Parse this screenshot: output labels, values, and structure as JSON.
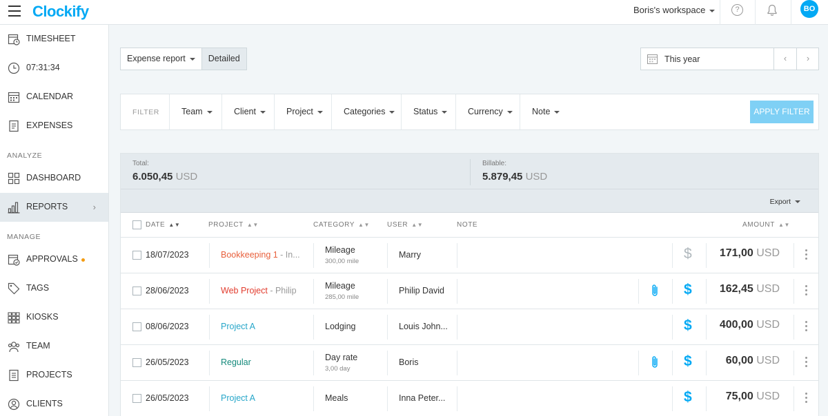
{
  "app": {
    "logo": "Clockify",
    "workspace": "Boris's workspace",
    "avatar": "BO"
  },
  "sidebar": {
    "items_top": [
      {
        "label": "TIMESHEET",
        "icon": "timesheet-icon"
      },
      {
        "label": "07:31:34",
        "icon": "clock-icon"
      },
      {
        "label": "CALENDAR",
        "icon": "calendar-icon"
      },
      {
        "label": "EXPENSES",
        "icon": "expenses-icon"
      }
    ],
    "section_analyze": "ANALYZE",
    "items_analyze": [
      {
        "label": "DASHBOARD",
        "icon": "dashboard-icon"
      },
      {
        "label": "REPORTS",
        "icon": "reports-icon"
      }
    ],
    "section_manage": "MANAGE",
    "items_manage": [
      {
        "label": "APPROVALS",
        "icon": "approvals-icon"
      },
      {
        "label": "TAGS",
        "icon": "tag-icon"
      },
      {
        "label": "KIOSKS",
        "icon": "kiosk-icon"
      },
      {
        "label": "TEAM",
        "icon": "team-icon"
      },
      {
        "label": "PROJECTS",
        "icon": "projects-icon"
      },
      {
        "label": "CLIENTS",
        "icon": "clients-icon"
      }
    ]
  },
  "report_type": {
    "selected": "Expense report",
    "detailed": "Detailed"
  },
  "date_range": {
    "label": "This year",
    "prev": "‹",
    "next": "›"
  },
  "filter": {
    "label": "FILTER",
    "items": [
      "Team",
      "Client",
      "Project",
      "Categories",
      "Status",
      "Currency",
      "Note"
    ],
    "apply": "APPLY FILTER"
  },
  "summary": {
    "total_label": "Total:",
    "total_value": "6.050,45",
    "total_currency": "USD",
    "billable_label": "Billable:",
    "billable_value": "5.879,45",
    "billable_currency": "USD"
  },
  "export_label": "Export",
  "columns": {
    "date": "DATE",
    "project": "PROJECT",
    "category": "CATEGORY",
    "user": "USER",
    "note": "NOTE",
    "amount": "AMOUNT"
  },
  "rows": [
    {
      "date": "18/07/2023",
      "project": "Bookkeeping 1",
      "client": " - In...",
      "project_color": "#e8603c",
      "category": "Mileage",
      "category_sub": "300,00 mile",
      "user": "Marry",
      "attachment": false,
      "billable": false,
      "amount": "171,00",
      "currency": "USD"
    },
    {
      "date": "28/06/2023",
      "project": "Web Project",
      "client": " - Philip",
      "project_color": "#e23c2e",
      "category": "Mileage",
      "category_sub": "285,00 mile",
      "user": "Philip David",
      "attachment": true,
      "billable": true,
      "amount": "162,45",
      "currency": "USD"
    },
    {
      "date": "08/06/2023",
      "project": "Project A",
      "client": "",
      "project_color": "#26a6c9",
      "category": "Lodging",
      "category_sub": "",
      "user": "Louis John...",
      "attachment": false,
      "billable": true,
      "amount": "400,00",
      "currency": "USD"
    },
    {
      "date": "26/05/2023",
      "project": "Regular",
      "client": "",
      "project_color": "#14897b",
      "category": "Day rate",
      "category_sub": "3,00 day",
      "user": "Boris",
      "attachment": true,
      "billable": true,
      "amount": "60,00",
      "currency": "USD"
    },
    {
      "date": "26/05/2023",
      "project": "Project A",
      "client": "",
      "project_color": "#26a6c9",
      "category": "Meals",
      "category_sub": "",
      "user": "Inna Peter...",
      "attachment": false,
      "billable": true,
      "amount": "75,00",
      "currency": "USD"
    }
  ],
  "colors": {
    "accent": "#03a9f4",
    "billable": "#03a9f4",
    "non_billable": "#b0b8bd"
  }
}
